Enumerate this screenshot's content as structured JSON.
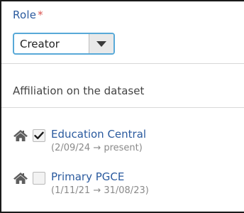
{
  "role": {
    "label": "Role",
    "required_marker": "*",
    "selected_value": "Creator"
  },
  "affiliation": {
    "heading": "Affiliation on the dataset",
    "items": [
      {
        "name": "Education Central",
        "dates": "(2/09/24 → present)",
        "checked": true,
        "icon": "home-icon"
      },
      {
        "name": "Primary PGCE",
        "dates": "(1/11/21 → 31/08/23)",
        "checked": false,
        "icon": "home-icon"
      }
    ]
  },
  "colors": {
    "label_blue": "#2a5a9e",
    "required_red": "#d9534f",
    "select_border": "#58a9d8"
  }
}
